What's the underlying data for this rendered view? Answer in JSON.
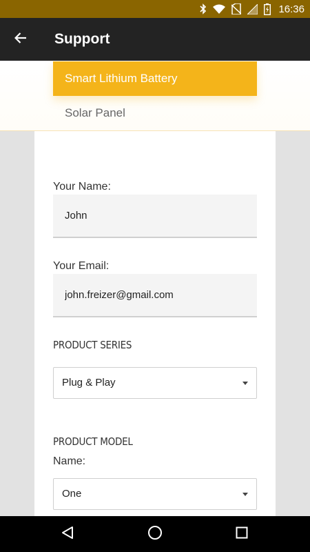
{
  "status_bar": {
    "time": "16:36",
    "icons": [
      "bluetooth-icon",
      "wifi-icon",
      "no-sim-icon",
      "signal-icon",
      "battery-charging-icon"
    ]
  },
  "app_bar": {
    "title": "Support",
    "back_icon": "arrow-back-icon"
  },
  "product_tabs": [
    {
      "label": "Smart Lithium Battery",
      "selected": true
    },
    {
      "label": "Solar Panel",
      "selected": false
    }
  ],
  "form": {
    "name": {
      "label": "Your Name:",
      "value": "John"
    },
    "email": {
      "label": "Your Email:",
      "value": "john.freizer@gmail.com"
    },
    "product_series": {
      "title": "PRODUCT SERIES",
      "selected": "Plug & Play"
    },
    "product_model": {
      "title": "PRODUCT MODEL",
      "name_label": "Name:",
      "selected": "One"
    }
  },
  "nav_bar": {
    "buttons": [
      "back-triangle-icon",
      "home-circle-icon",
      "recents-square-icon"
    ]
  },
  "colors": {
    "status_bar": "#8a6500",
    "app_bar": "#232323",
    "accent": "#f4b41a"
  }
}
